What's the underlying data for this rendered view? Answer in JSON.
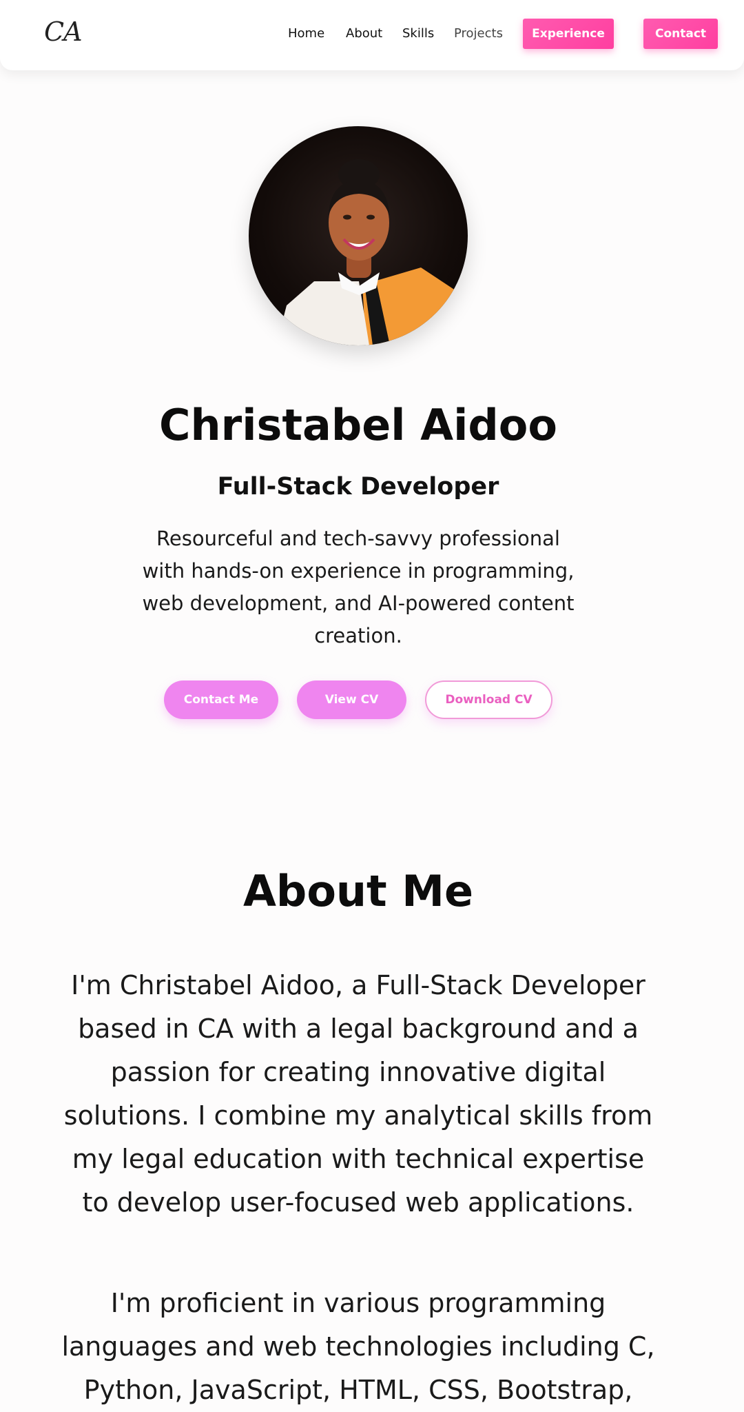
{
  "nav": {
    "logo": "CA",
    "links": [
      "Home",
      "About",
      "Skills",
      "Projects"
    ],
    "experience_label": "Experience",
    "contact_label": "Contact"
  },
  "hero": {
    "name": "Christabel Aidoo",
    "role": "Full-Stack Developer",
    "description": "Resourceful and tech-savvy professional with hands-on experience in programming, web development, and AI-powered content creation.",
    "buttons": {
      "contact_me": "Contact Me",
      "view_cv": "View CV",
      "download_cv": "Download CV"
    }
  },
  "about": {
    "title": "About Me",
    "paragraph1": "I'm Christabel Aidoo, a Full-Stack Developer based in CA with a legal background and a passion for creating innovative digital solutions. I combine my analytical skills from my legal education with technical expertise to develop user-focused web applications.",
    "paragraph2": "I'm proficient in various programming languages and web technologies including C, Python, JavaScript, HTML, CSS, Bootstrap,"
  },
  "colors": {
    "accent_pink": "#ff4fa8",
    "pill_pink": "#ef85ef",
    "outline_pink": "#ea5fc0"
  }
}
